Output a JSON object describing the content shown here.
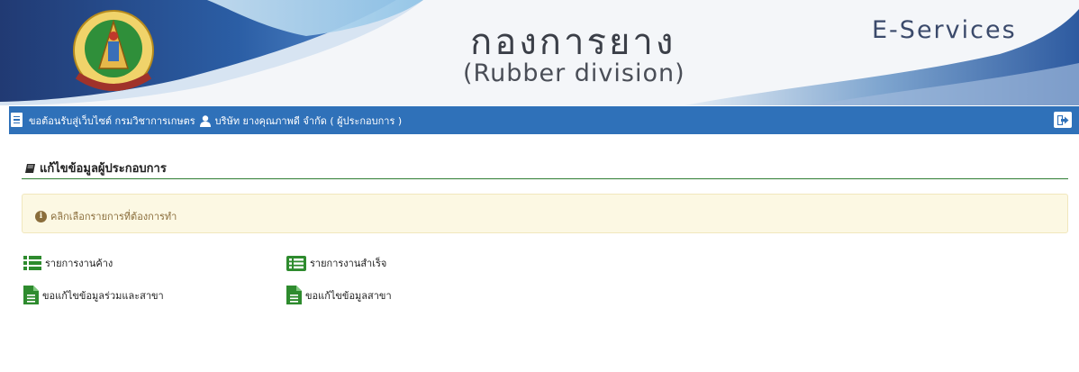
{
  "header": {
    "title_thai": "กองการยาง",
    "title_english": "(Rubber division)",
    "service_name": "E-Services",
    "logo_caption": "กรมวิชาการเกษตร"
  },
  "navbar": {
    "welcome_text": "ขอต้อนรับสู่เว็บไซต์ กรมวิชาการเกษตร",
    "user_text": "บริษัท ยางคุณภาพดี จำกัด ( ผู้ประกอบการ )",
    "color": "#2f71b9"
  },
  "section": {
    "title": "แก้ไขข้อมูลผู้ประกอบการ"
  },
  "alert": {
    "text": "คลิกเลือกรายการที่ต้องการทำ"
  },
  "links": [
    {
      "label": "รายการงานค้าง",
      "icon": "list-icon"
    },
    {
      "label": "รายการงานสำเร็จ",
      "icon": "list-alt-icon"
    },
    {
      "label": "ขอแก้ไขข้อมูลร่วมและสาขา",
      "icon": "file-icon"
    },
    {
      "label": "ขอแก้ไขข้อมูลสาขา",
      "icon": "file-icon"
    }
  ],
  "colors": {
    "accent_green": "#2e7d32",
    "alert_bg": "#fcf8e3",
    "alert_text": "#8a6d3b"
  }
}
